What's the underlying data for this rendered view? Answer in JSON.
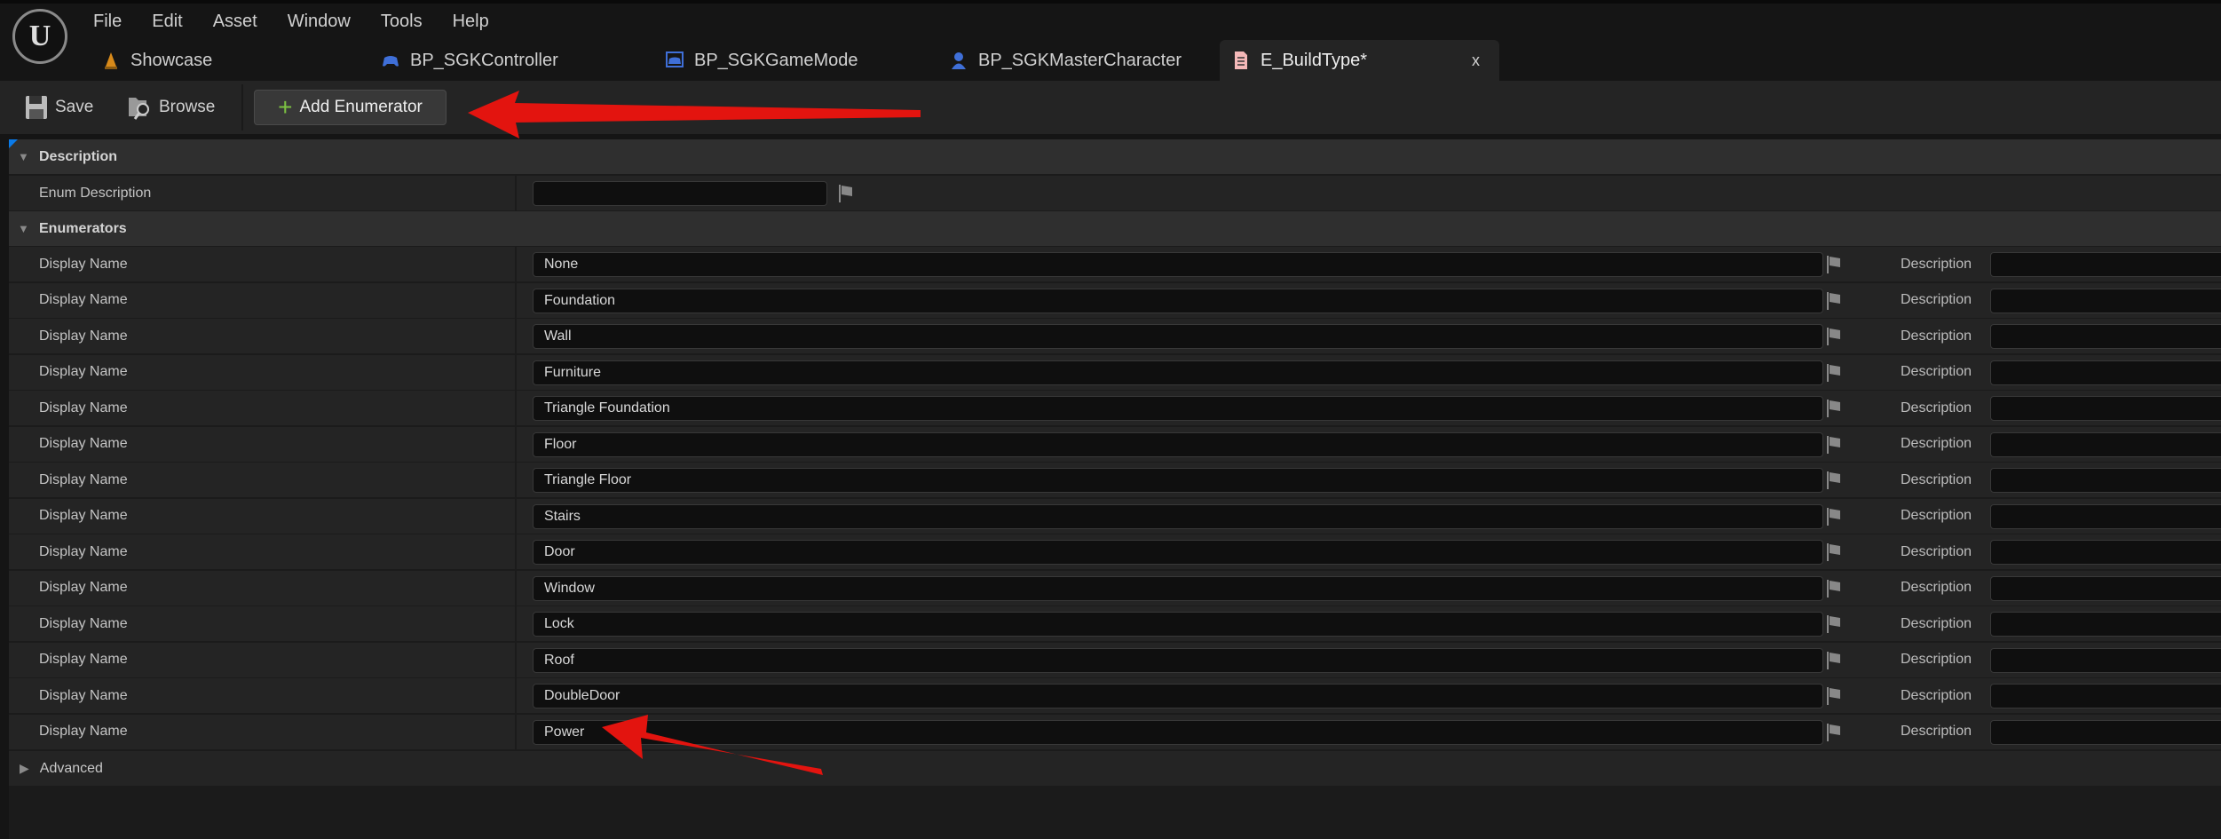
{
  "menu": [
    "File",
    "Edit",
    "Asset",
    "Window",
    "Tools",
    "Help"
  ],
  "tabs": [
    {
      "label": "Showcase",
      "icon": "level-icon",
      "color": "#d88a1a"
    },
    {
      "label": "BP_SGKController",
      "icon": "gamepad-icon",
      "color": "#3f6fd8"
    },
    {
      "label": "BP_SGKGameMode",
      "icon": "gamemode-icon",
      "color": "#3f6fd8"
    },
    {
      "label": "BP_SGKMasterCharacter",
      "icon": "character-icon",
      "color": "#3f6fd8"
    },
    {
      "label": "E_BuildType*",
      "icon": "enum-icon",
      "color": "#f4b8b8",
      "close": "x"
    }
  ],
  "toolbar": {
    "save": "Save",
    "browse": "Browse",
    "add": "Add Enumerator"
  },
  "sections": {
    "description": "Description",
    "enum_description": "Enum Description",
    "enumerators": "Enumerators",
    "advanced": "Advanced"
  },
  "enum_description_value": "",
  "row_label": "Display Name",
  "desc_label": "Description",
  "enumerators": [
    "None",
    "Foundation",
    "Wall",
    "Furniture",
    "Triangle Foundation",
    "Floor",
    "Triangle Floor",
    "Stairs",
    "Door",
    "Window",
    "Lock",
    "Roof",
    "DoubleDoor",
    "Power"
  ],
  "annotation_color": "#e3140f"
}
